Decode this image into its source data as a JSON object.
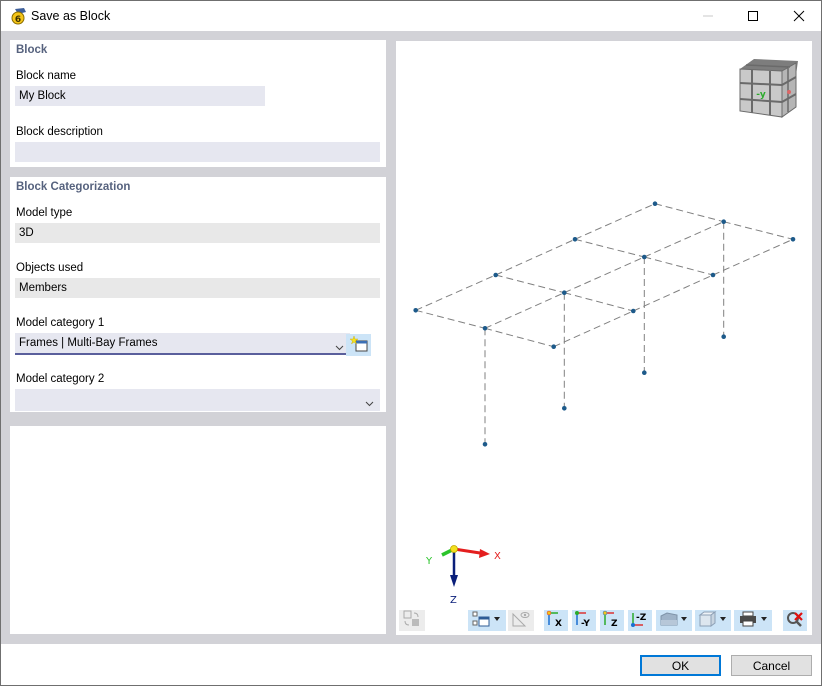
{
  "window": {
    "title": "Save as Block",
    "controls": [
      "minimize",
      "maximize",
      "close"
    ]
  },
  "block": {
    "section_title": "Block",
    "name_label": "Block name",
    "name_value": "My Block",
    "description_label": "Block description",
    "description_value": ""
  },
  "categorization": {
    "section_title": "Block Categorization",
    "model_type_label": "Model type",
    "model_type_value": "3D",
    "objects_used_label": "Objects used",
    "objects_used_value": "Members",
    "model_category_1_label": "Model category 1",
    "model_category_1_value": "Frames | Multi-Bay Frames",
    "model_category_2_label": "Model category 2",
    "model_category_2_value": ""
  },
  "viewport": {
    "nav_cube_face_label": "-y",
    "axes": {
      "x": "X",
      "y": "Y",
      "z": "Z"
    },
    "colors": {
      "node": "#1d5a8a",
      "member": "#808080",
      "x_axis": "#e41e1e",
      "y_axis": "#2bc42b",
      "z_axis": "#0a1f7a"
    }
  },
  "toolbar": {
    "buttons": [
      {
        "name": "refresh-view",
        "enabled": false
      },
      {
        "name": "display-properties",
        "enabled": true,
        "dropdown": true
      },
      {
        "name": "measure-visibility",
        "enabled": false
      },
      {
        "name": "view-x",
        "label": "X",
        "enabled": true
      },
      {
        "name": "view-minus-y",
        "label": "-Y",
        "enabled": true
      },
      {
        "name": "view-z",
        "label": "Z",
        "enabled": true
      },
      {
        "name": "view-minus-z",
        "label": "-Z",
        "enabled": true
      },
      {
        "name": "render-style",
        "enabled": true,
        "dropdown": true
      },
      {
        "name": "transparency",
        "enabled": true,
        "dropdown": true
      },
      {
        "name": "print",
        "enabled": true,
        "dropdown": true
      },
      {
        "name": "reset-zoom",
        "enabled": true
      }
    ]
  },
  "footer": {
    "ok_label": "OK",
    "cancel_label": "Cancel"
  }
}
